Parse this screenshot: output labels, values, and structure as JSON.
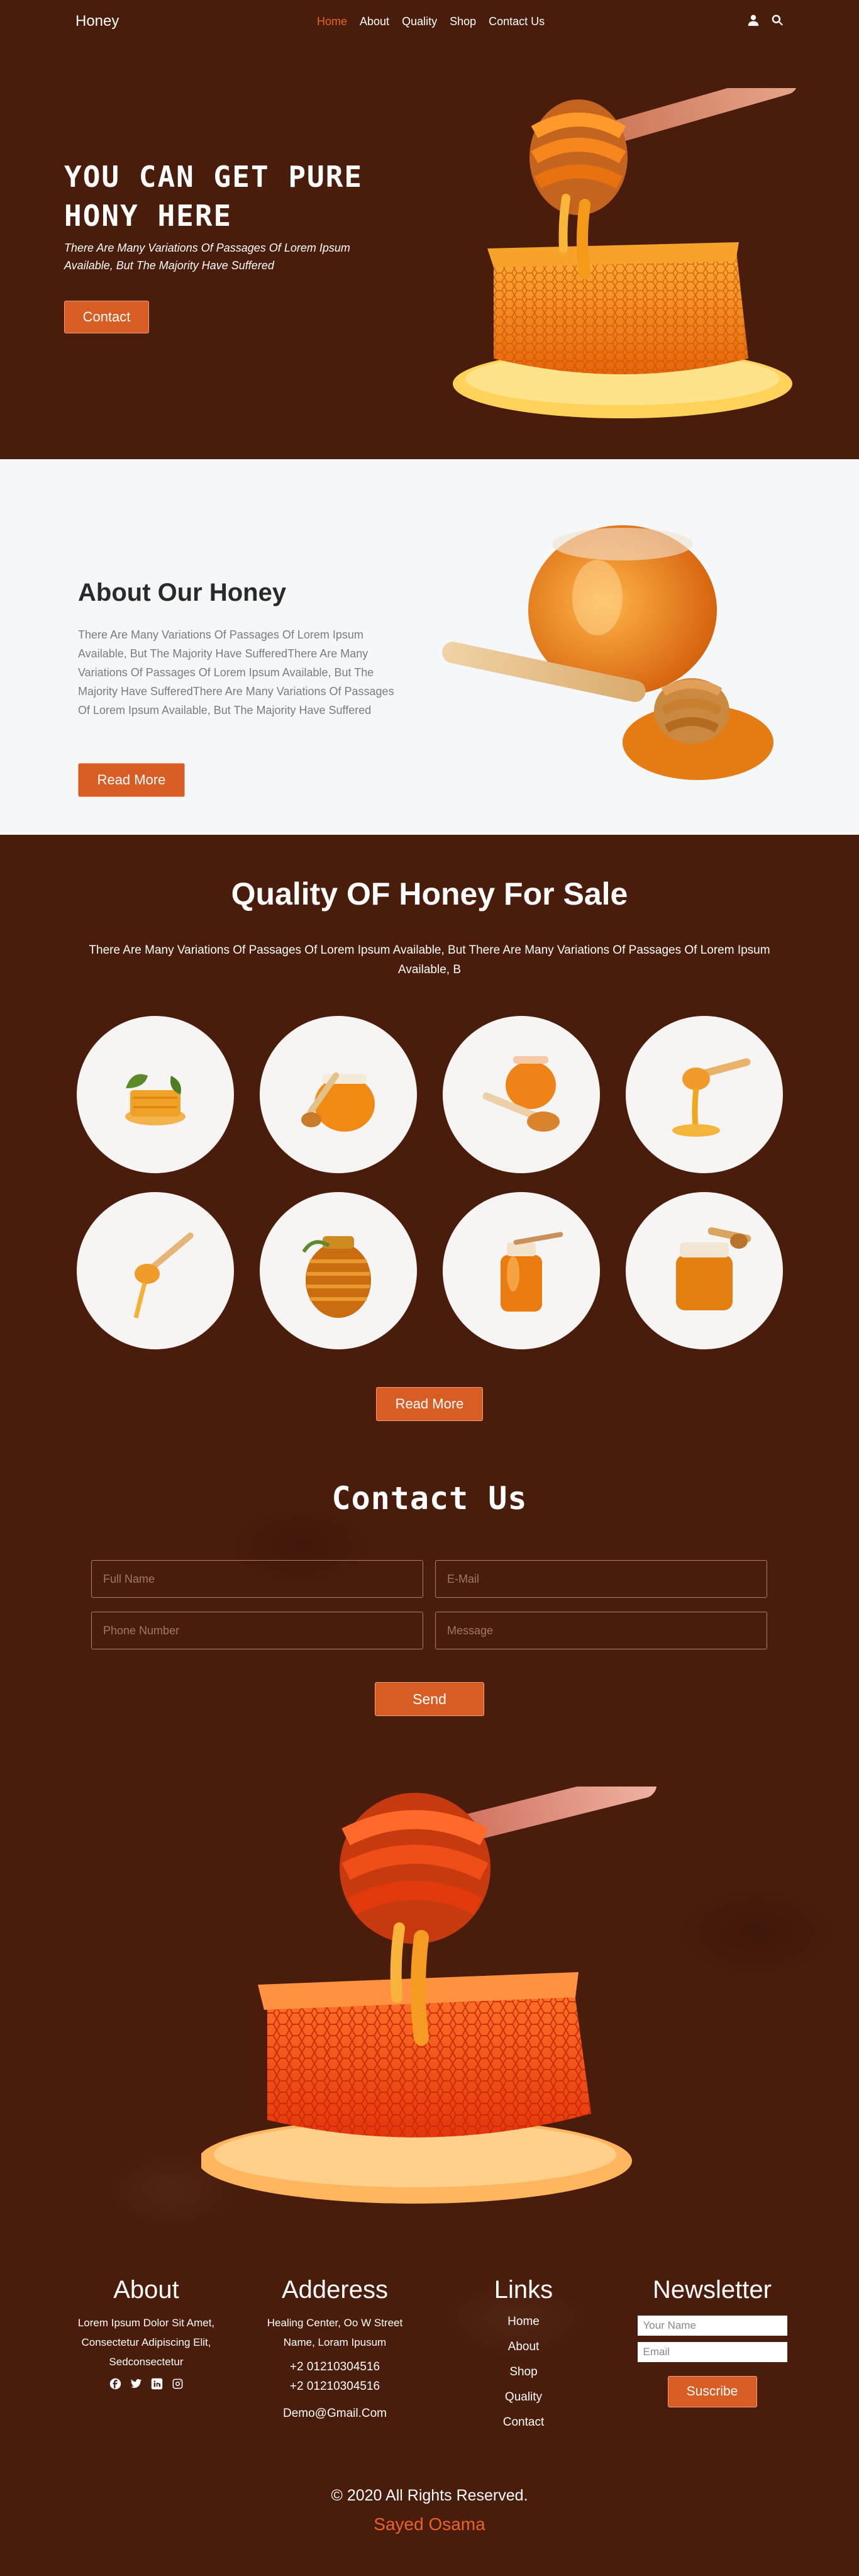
{
  "nav": {
    "brand": "Honey",
    "links": [
      "Home",
      "About",
      "Quality",
      "Shop",
      "Contact Us"
    ],
    "active_index": 0,
    "icons": [
      "user-icon",
      "search-icon"
    ]
  },
  "hero": {
    "title": "YOU CAN GET PURE HONY HERE",
    "subtitle": "There Are Many Variations Of Passages Of Lorem Ipsum Available, But The Majority Have Suffered",
    "button": "Contact"
  },
  "about": {
    "title": "About Our Honey",
    "text": "There Are Many Variations Of Passages Of Lorem Ipsum Available, But The Majority Have SufferedThere Are Many Variations Of Passages Of Lorem Ipsum Available, But The Majority Have SufferedThere Are Many Variations Of Passages Of Lorem Ipsum Available, But The Majority Have Suffered",
    "button": "Read More"
  },
  "quality": {
    "title": "Quality OF Honey For Sale",
    "subtitle": "There Are Many Variations Of Passages Of Lorem Ipsum Available, But There Are Many Variations Of Passages Of Lorem Ipsum Available, B",
    "button": "Read More",
    "products": [
      "honey-comb-image",
      "honey-jar-dipper-image",
      "honey-pot-image",
      "honey-drip-image",
      "dipper-drip-image",
      "beehive-jar-image",
      "honey-bottle-image",
      "honey-jar-image"
    ]
  },
  "contact": {
    "title": "Contact Us",
    "full_name_placeholder": "Full Name",
    "email_placeholder": "E-Mail",
    "phone_placeholder": "Phone Number",
    "message_placeholder": "Message",
    "send": "Send"
  },
  "footer": {
    "about": {
      "title": "About",
      "text": "Lorem Ipsum Dolor Sit Amet, Consectetur Adipiscing Elit, Sedconsectetur",
      "socials": [
        "facebook-icon",
        "twitter-icon",
        "linkedin-icon",
        "instagram-icon"
      ]
    },
    "address": {
      "title": "Adderess",
      "text": "Healing Center, Oo W Street Name, Loram Ipusum",
      "phone1": "+2 01210304516",
      "phone2": "+2 01210304516",
      "email": "Demo@Gmail.Com"
    },
    "links": {
      "title": "Links",
      "items": [
        "Home",
        "About",
        "Shop",
        "Quality",
        "Contact"
      ]
    },
    "newsletter": {
      "title": "Newsletter",
      "name_placeholder": "Your Name",
      "email_placeholder": "Email",
      "button": "Suscribe"
    },
    "copyright": "© 2020 All Rights Reserved.",
    "author": "Sayed Osama"
  },
  "colors": {
    "accent": "#d85d25",
    "background": "#4a1c0b",
    "light": "#f6f7f9"
  }
}
